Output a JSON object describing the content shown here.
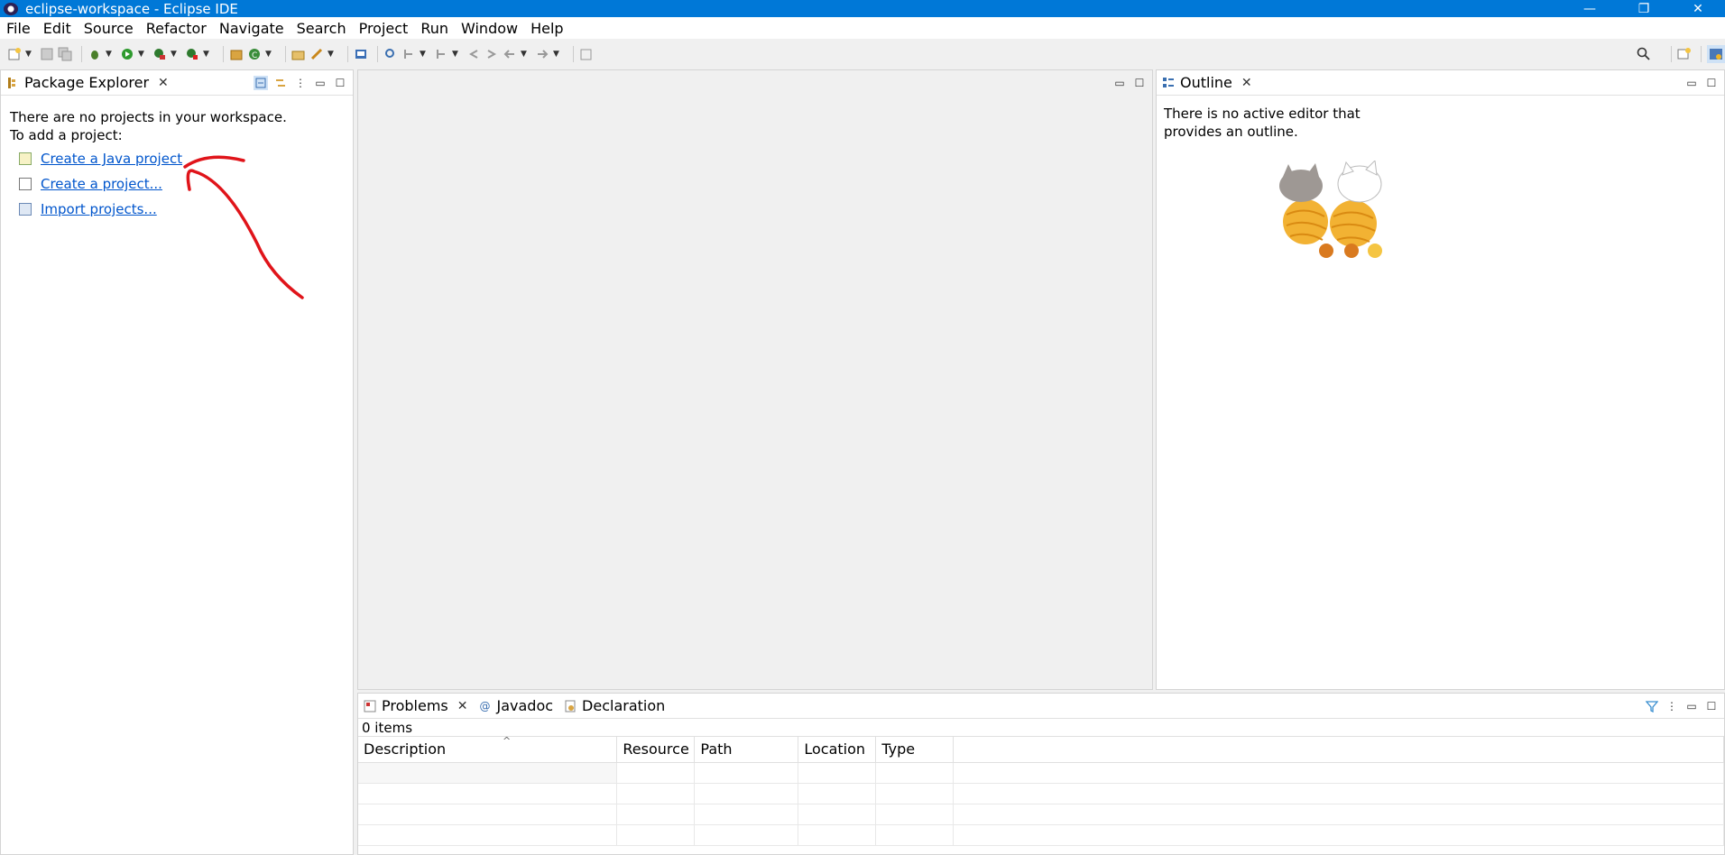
{
  "window": {
    "title": "eclipse-workspace - Eclipse IDE",
    "controls": [
      "—",
      "❐",
      "✕"
    ]
  },
  "menu": [
    "File",
    "Edit",
    "Source",
    "Refactor",
    "Navigate",
    "Search",
    "Project",
    "Run",
    "Window",
    "Help"
  ],
  "package_explorer": {
    "tab_label": "Package Explorer",
    "message_line1": "There are no projects in your workspace.",
    "message_line2": "To add a project:",
    "links": [
      {
        "label": "Create a Java project"
      },
      {
        "label": "Create a project..."
      },
      {
        "label": "Import projects..."
      }
    ]
  },
  "outline": {
    "tab_label": "Outline",
    "message": "There is no active editor that provides an outline."
  },
  "bottom": {
    "tabs": [
      {
        "label": "Problems",
        "icon": "problems-icon"
      },
      {
        "label": "Javadoc",
        "icon": "at-icon"
      },
      {
        "label": "Declaration",
        "icon": "declaration-icon"
      }
    ],
    "item_count": "0 items",
    "columns": [
      "Description",
      "Resource",
      "Path",
      "Location",
      "Type"
    ]
  },
  "colors": {
    "titlebar": "#0078d7",
    "link": "#0055cc",
    "annotation": "#e0141a"
  }
}
